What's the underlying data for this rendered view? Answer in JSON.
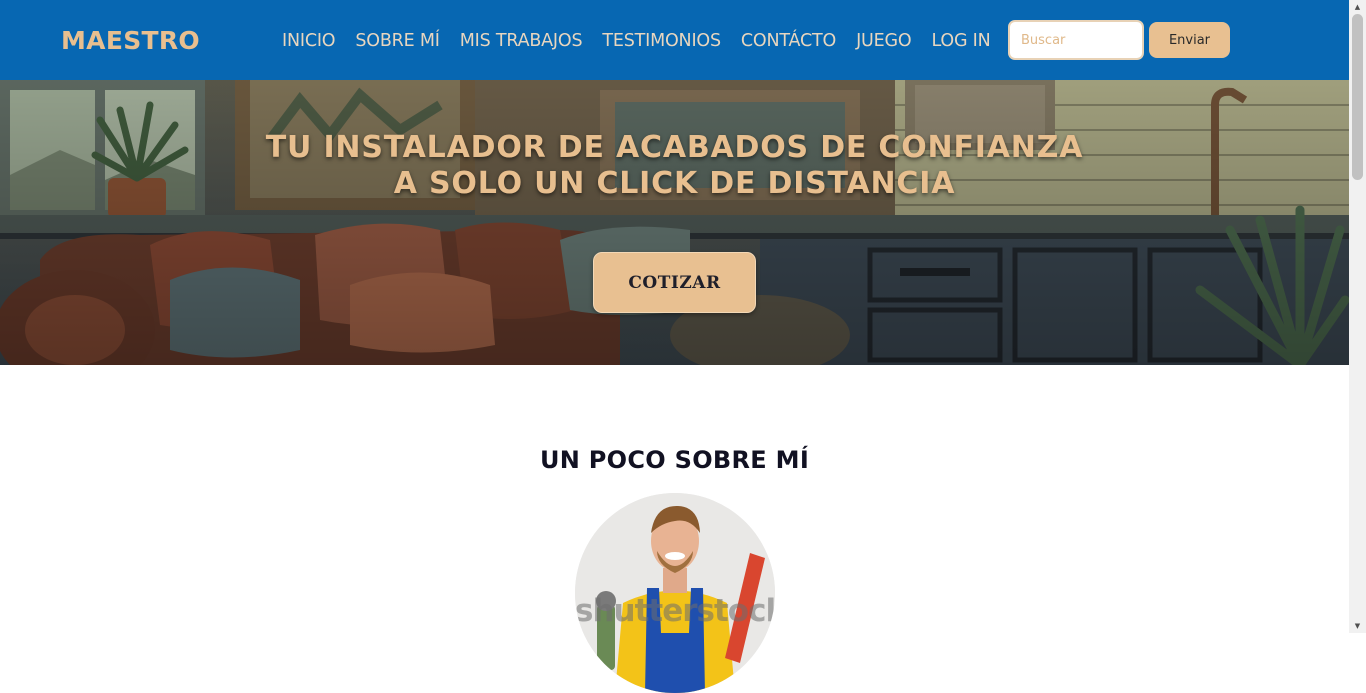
{
  "brand": {
    "name": "MAESTRO"
  },
  "nav": {
    "items": [
      {
        "label": "INICIO"
      },
      {
        "label": "SOBRE MÍ"
      },
      {
        "label": "MIS TRABAJOS"
      },
      {
        "label": "TESTIMONIOS"
      },
      {
        "label": "CONTÁCTO"
      },
      {
        "label": "JUEGO"
      },
      {
        "label": "LOG IN"
      }
    ]
  },
  "search": {
    "placeholder": "Buscar",
    "value": "",
    "button_label": "Enviar"
  },
  "hero": {
    "title_line1": "TU INSTALADOR DE ACABADOS DE CONFIANZA",
    "title_line2": "A SOLO UN CLICK DE DISTANCIA",
    "cta_label": "COTIZAR"
  },
  "about": {
    "title": "UN POCO SOBRE MÍ",
    "photo_watermark": "shutterstock"
  },
  "colors": {
    "navbar": "#0767b2",
    "accent": "#e8bf8f",
    "button": "#e8c091",
    "text_dark": "#111122"
  },
  "icons": {
    "scroll_up": "scroll-up-arrow-icon",
    "scroll_down": "scroll-down-arrow-icon"
  }
}
